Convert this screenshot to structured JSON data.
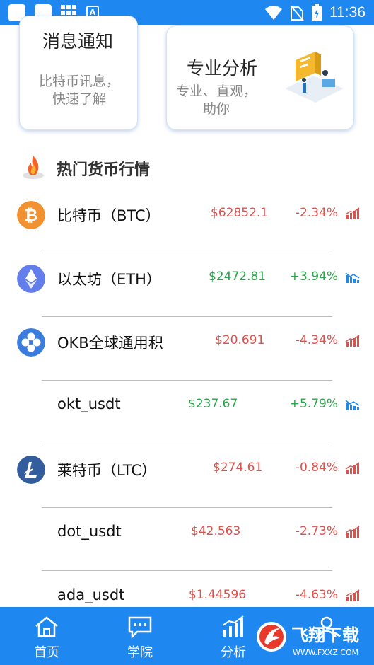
{
  "status_bar": {
    "time": "11:36"
  },
  "cards": [
    {
      "title": "消息通知",
      "subtitle_line1": "比特币讯息，",
      "subtitle_line2": "快速了解"
    },
    {
      "title": "专业分析",
      "subtitle_line1": "专业、直观，",
      "subtitle_line2": "助你"
    }
  ],
  "section": {
    "title": "热门货币行情"
  },
  "coins": [
    {
      "name": "比特币（BTC）",
      "price": "$62852.1",
      "change": "-2.34%",
      "direction": "down",
      "icon": "bitcoin-icon"
    },
    {
      "name": "以太坊（ETH）",
      "price": "$2472.81",
      "change": "+3.94%",
      "direction": "up",
      "icon": "ethereum-icon"
    },
    {
      "name": "OKB全球通用积",
      "price": "$20.691",
      "change": "-4.34%",
      "direction": "down",
      "icon": "okb-icon"
    },
    {
      "name": "okt_usdt",
      "price": "$237.67",
      "change": "+5.79%",
      "direction": "up",
      "icon": ""
    },
    {
      "name": "莱特币（LTC）",
      "price": "$274.61",
      "change": "-0.84%",
      "direction": "down",
      "icon": "litecoin-icon"
    },
    {
      "name": "dot_usdt",
      "price": "$42.563",
      "change": "-2.73%",
      "direction": "down",
      "icon": ""
    },
    {
      "name": "ada_usdt",
      "price": "$1.44596",
      "change": "-4.63%",
      "direction": "down",
      "icon": ""
    }
  ],
  "tabs": [
    {
      "label": "首页",
      "icon": "home-icon"
    },
    {
      "label": "学院",
      "icon": "chat-icon"
    },
    {
      "label": "分析",
      "icon": "chart-icon"
    },
    {
      "label": "",
      "icon": "user-icon"
    }
  ],
  "watermark": {
    "text": "飞翔下载",
    "url": "WWW.FXXZ.COM"
  },
  "colors": {
    "accent": "#1e88f0",
    "down": "#d9534f",
    "up": "#2aa34a"
  }
}
